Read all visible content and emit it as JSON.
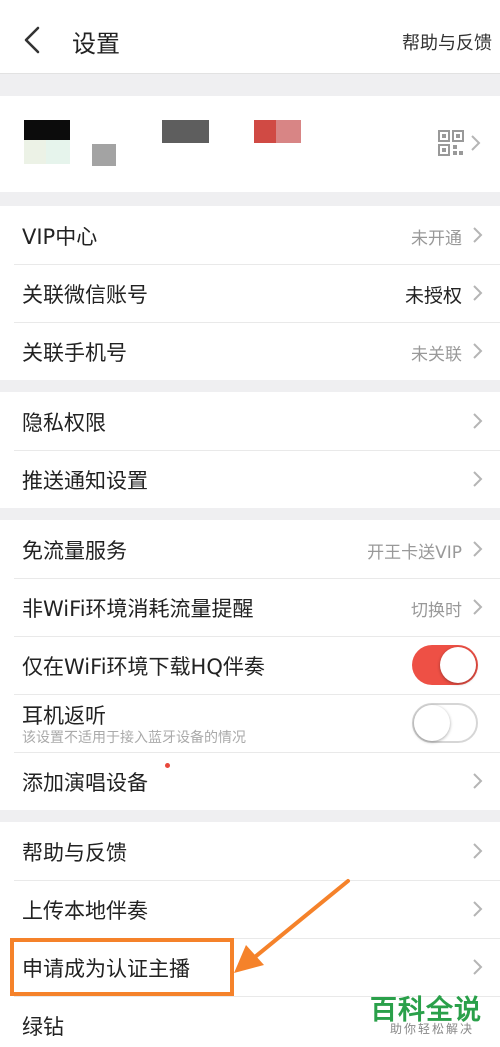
{
  "header": {
    "title": "设置",
    "help_link": "帮助与反馈"
  },
  "profile": {
    "qr_icon": "qrcode-icon"
  },
  "sections": {
    "account": [
      {
        "label": "VIP中心",
        "value": "未开通"
      },
      {
        "label": "关联微信账号",
        "value": "未授权"
      },
      {
        "label": "关联手机号",
        "value": "未关联"
      }
    ],
    "privacy": [
      {
        "label": "隐私权限"
      },
      {
        "label": "推送通知设置"
      }
    ],
    "network": [
      {
        "label": "免流量服务",
        "value": "开王卡送VIP"
      },
      {
        "label": "非WiFi环境消耗流量提醒",
        "value": "切换时"
      },
      {
        "label": "仅在WiFi环境下载HQ伴奏",
        "toggle": true
      },
      {
        "label": "耳机返听",
        "sub": "该设置不适用于接入蓝牙设备的情况",
        "toggle": false
      },
      {
        "label": "添加演唱设备"
      }
    ],
    "help": [
      {
        "label": "帮助与反馈"
      },
      {
        "label": "上传本地伴奏"
      },
      {
        "label": "申请成为认证主播"
      },
      {
        "label": "绿钻"
      }
    ]
  },
  "colors": {
    "toggle_on": "#ee5045",
    "annotation": "#f5822a",
    "watermark": "#2aa04a"
  },
  "watermark": {
    "main": "百科全说",
    "sub": "助你轻松解决"
  }
}
